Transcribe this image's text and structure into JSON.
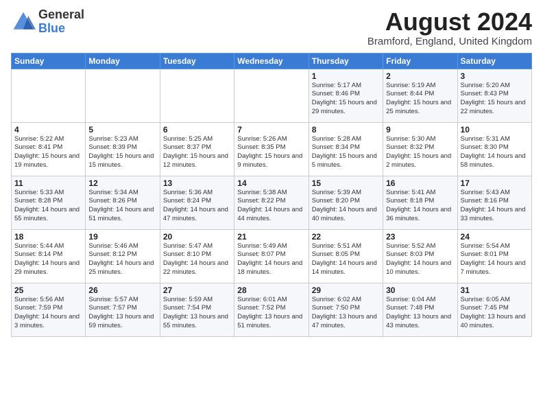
{
  "header": {
    "logo_general": "General",
    "logo_blue": "Blue",
    "month_year": "August 2024",
    "location": "Bramford, England, United Kingdom"
  },
  "weekdays": [
    "Sunday",
    "Monday",
    "Tuesday",
    "Wednesday",
    "Thursday",
    "Friday",
    "Saturday"
  ],
  "weeks": [
    [
      {
        "day": "",
        "info": ""
      },
      {
        "day": "",
        "info": ""
      },
      {
        "day": "",
        "info": ""
      },
      {
        "day": "",
        "info": ""
      },
      {
        "day": "1",
        "info": "Sunrise: 5:17 AM\nSunset: 8:46 PM\nDaylight: 15 hours\nand 29 minutes."
      },
      {
        "day": "2",
        "info": "Sunrise: 5:19 AM\nSunset: 8:44 PM\nDaylight: 15 hours\nand 25 minutes."
      },
      {
        "day": "3",
        "info": "Sunrise: 5:20 AM\nSunset: 8:43 PM\nDaylight: 15 hours\nand 22 minutes."
      }
    ],
    [
      {
        "day": "4",
        "info": "Sunrise: 5:22 AM\nSunset: 8:41 PM\nDaylight: 15 hours\nand 19 minutes."
      },
      {
        "day": "5",
        "info": "Sunrise: 5:23 AM\nSunset: 8:39 PM\nDaylight: 15 hours\nand 15 minutes."
      },
      {
        "day": "6",
        "info": "Sunrise: 5:25 AM\nSunset: 8:37 PM\nDaylight: 15 hours\nand 12 minutes."
      },
      {
        "day": "7",
        "info": "Sunrise: 5:26 AM\nSunset: 8:35 PM\nDaylight: 15 hours\nand 9 minutes."
      },
      {
        "day": "8",
        "info": "Sunrise: 5:28 AM\nSunset: 8:34 PM\nDaylight: 15 hours\nand 5 minutes."
      },
      {
        "day": "9",
        "info": "Sunrise: 5:30 AM\nSunset: 8:32 PM\nDaylight: 15 hours\nand 2 minutes."
      },
      {
        "day": "10",
        "info": "Sunrise: 5:31 AM\nSunset: 8:30 PM\nDaylight: 14 hours\nand 58 minutes."
      }
    ],
    [
      {
        "day": "11",
        "info": "Sunrise: 5:33 AM\nSunset: 8:28 PM\nDaylight: 14 hours\nand 55 minutes."
      },
      {
        "day": "12",
        "info": "Sunrise: 5:34 AM\nSunset: 8:26 PM\nDaylight: 14 hours\nand 51 minutes."
      },
      {
        "day": "13",
        "info": "Sunrise: 5:36 AM\nSunset: 8:24 PM\nDaylight: 14 hours\nand 47 minutes."
      },
      {
        "day": "14",
        "info": "Sunrise: 5:38 AM\nSunset: 8:22 PM\nDaylight: 14 hours\nand 44 minutes."
      },
      {
        "day": "15",
        "info": "Sunrise: 5:39 AM\nSunset: 8:20 PM\nDaylight: 14 hours\nand 40 minutes."
      },
      {
        "day": "16",
        "info": "Sunrise: 5:41 AM\nSunset: 8:18 PM\nDaylight: 14 hours\nand 36 minutes."
      },
      {
        "day": "17",
        "info": "Sunrise: 5:43 AM\nSunset: 8:16 PM\nDaylight: 14 hours\nand 33 minutes."
      }
    ],
    [
      {
        "day": "18",
        "info": "Sunrise: 5:44 AM\nSunset: 8:14 PM\nDaylight: 14 hours\nand 29 minutes."
      },
      {
        "day": "19",
        "info": "Sunrise: 5:46 AM\nSunset: 8:12 PM\nDaylight: 14 hours\nand 25 minutes."
      },
      {
        "day": "20",
        "info": "Sunrise: 5:47 AM\nSunset: 8:10 PM\nDaylight: 14 hours\nand 22 minutes."
      },
      {
        "day": "21",
        "info": "Sunrise: 5:49 AM\nSunset: 8:07 PM\nDaylight: 14 hours\nand 18 minutes."
      },
      {
        "day": "22",
        "info": "Sunrise: 5:51 AM\nSunset: 8:05 PM\nDaylight: 14 hours\nand 14 minutes."
      },
      {
        "day": "23",
        "info": "Sunrise: 5:52 AM\nSunset: 8:03 PM\nDaylight: 14 hours\nand 10 minutes."
      },
      {
        "day": "24",
        "info": "Sunrise: 5:54 AM\nSunset: 8:01 PM\nDaylight: 14 hours\nand 7 minutes."
      }
    ],
    [
      {
        "day": "25",
        "info": "Sunrise: 5:56 AM\nSunset: 7:59 PM\nDaylight: 14 hours\nand 3 minutes."
      },
      {
        "day": "26",
        "info": "Sunrise: 5:57 AM\nSunset: 7:57 PM\nDaylight: 13 hours\nand 59 minutes."
      },
      {
        "day": "27",
        "info": "Sunrise: 5:59 AM\nSunset: 7:54 PM\nDaylight: 13 hours\nand 55 minutes."
      },
      {
        "day": "28",
        "info": "Sunrise: 6:01 AM\nSunset: 7:52 PM\nDaylight: 13 hours\nand 51 minutes."
      },
      {
        "day": "29",
        "info": "Sunrise: 6:02 AM\nSunset: 7:50 PM\nDaylight: 13 hours\nand 47 minutes."
      },
      {
        "day": "30",
        "info": "Sunrise: 6:04 AM\nSunset: 7:48 PM\nDaylight: 13 hours\nand 43 minutes."
      },
      {
        "day": "31",
        "info": "Sunrise: 6:05 AM\nSunset: 7:45 PM\nDaylight: 13 hours\nand 40 minutes."
      }
    ]
  ]
}
